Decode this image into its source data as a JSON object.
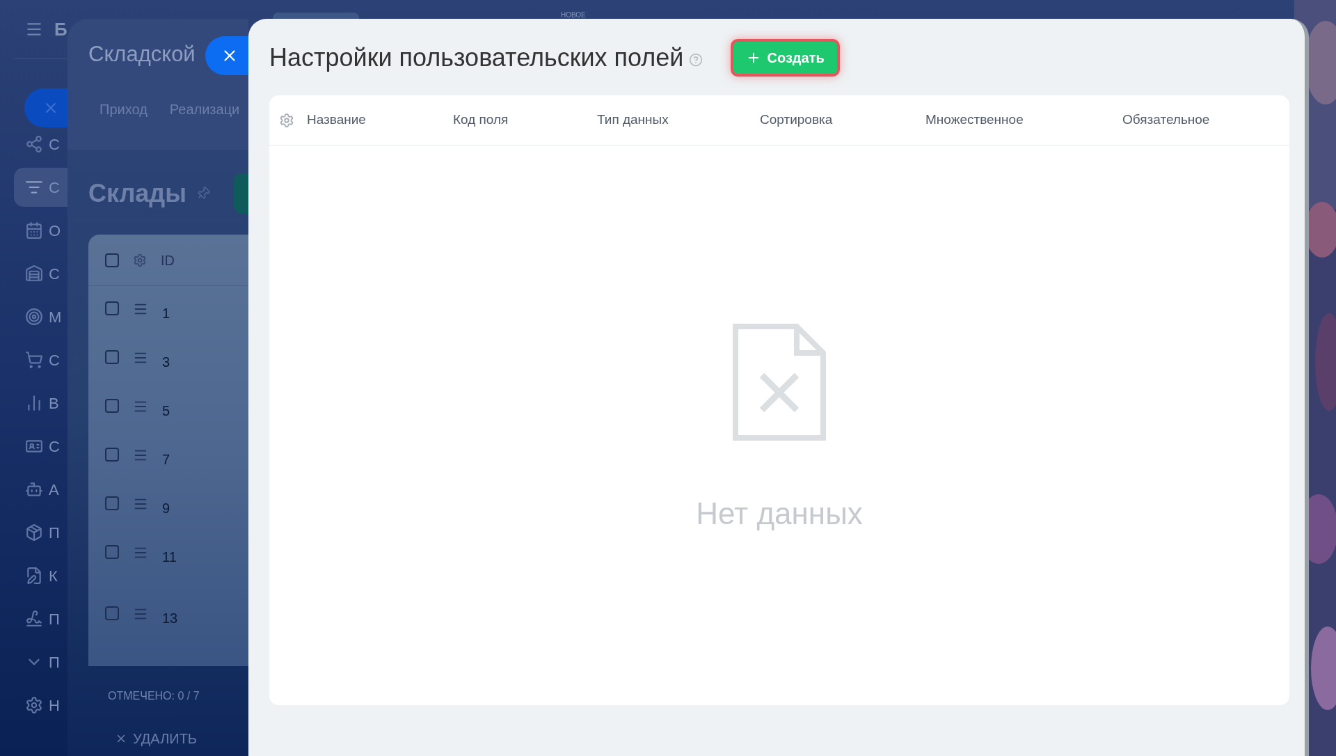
{
  "sidebar": {
    "header_letter": "Б",
    "items": [
      {
        "label": "С",
        "selected": false
      },
      {
        "label": "С",
        "selected": true
      },
      {
        "label": "О",
        "selected": false
      },
      {
        "label": "С",
        "selected": false
      },
      {
        "label": "М",
        "selected": false
      },
      {
        "label": "С",
        "selected": false
      },
      {
        "label": "В",
        "selected": false
      },
      {
        "label": "С",
        "selected": false
      },
      {
        "label": "А",
        "selected": false
      },
      {
        "label": "П",
        "selected": false
      },
      {
        "label": "К",
        "selected": false
      },
      {
        "label": "П",
        "selected": false
      },
      {
        "label": "П",
        "selected": false
      },
      {
        "label": "Н",
        "selected": false
      }
    ]
  },
  "top_badge": "НОВОЕ",
  "background_panel": {
    "title": "Складской",
    "tabs": [
      "Приход",
      "Реализаци"
    ],
    "heading": "Склады",
    "table": {
      "header": {
        "checked": false,
        "column": "ID"
      },
      "rows": [
        {
          "number": "1",
          "checked": false
        },
        {
          "number": "3",
          "checked": false
        },
        {
          "number": "5",
          "checked": false
        },
        {
          "number": "7",
          "checked": false
        },
        {
          "number": "9",
          "checked": false
        },
        {
          "number": "11",
          "checked": false
        },
        {
          "number": "13",
          "checked": false
        }
      ]
    },
    "footer": {
      "selected_count": "ОТМЕЧЕНО: 0 / 7",
      "delete_button": "УДАЛИТЬ"
    }
  },
  "modal": {
    "title": "Настройки пользовательских полей",
    "create_button": "Создать",
    "table": {
      "columns": [
        "Название",
        "Код поля",
        "Тип данных",
        "Сортировка",
        "Множественное",
        "Обязательное"
      ]
    },
    "empty_state": "Нет данных"
  }
}
